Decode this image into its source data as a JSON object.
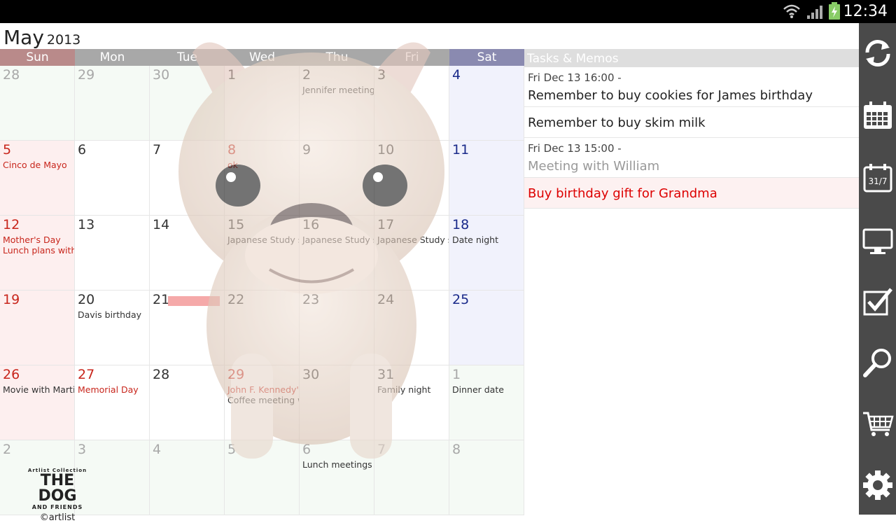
{
  "status": {
    "time": "12:34"
  },
  "calendar": {
    "month": "May",
    "year": "2013",
    "weekdays": [
      "Sun",
      "Mon",
      "Tue",
      "Wed",
      "Thu",
      "Fri",
      "Sat"
    ],
    "weeks": [
      [
        {
          "d": "28",
          "kind": "other"
        },
        {
          "d": "29",
          "kind": "other"
        },
        {
          "d": "30",
          "kind": "other"
        },
        {
          "d": "1"
        },
        {
          "d": "2",
          "events": [
            "Jennifer meeting"
          ]
        },
        {
          "d": "3"
        },
        {
          "d": "4"
        }
      ],
      [
        {
          "d": "5",
          "events": [
            "Cinco de Mayo"
          ],
          "evred": true
        },
        {
          "d": "6"
        },
        {
          "d": "7"
        },
        {
          "d": "8",
          "red": true,
          "events": [
            "ok"
          ],
          "evred": true
        },
        {
          "d": "9"
        },
        {
          "d": "10"
        },
        {
          "d": "11"
        }
      ],
      [
        {
          "d": "12",
          "events": [
            "Mother's Day",
            "Lunch plans with"
          ],
          "evred": true
        },
        {
          "d": "13"
        },
        {
          "d": "14"
        },
        {
          "d": "15",
          "events": [
            "Japanese Study s"
          ]
        },
        {
          "d": "16",
          "events": [
            "Japanese Study s"
          ]
        },
        {
          "d": "17",
          "events": [
            "Japanese Study s"
          ]
        },
        {
          "d": "18",
          "events": [
            "Date night"
          ]
        }
      ],
      [
        {
          "d": "19"
        },
        {
          "d": "20",
          "events": [
            "Davis birthday"
          ]
        },
        {
          "d": "21",
          "today": true
        },
        {
          "d": "22"
        },
        {
          "d": "23"
        },
        {
          "d": "24"
        },
        {
          "d": "25"
        }
      ],
      [
        {
          "d": "26",
          "events": [
            "Movie with Martin"
          ]
        },
        {
          "d": "27",
          "red": true,
          "events": [
            "Memorial Day"
          ],
          "evred": true
        },
        {
          "d": "28"
        },
        {
          "d": "29",
          "red": true,
          "events": [
            "John F. Kennedy's",
            "Coffee meeting w"
          ],
          "mixed": true
        },
        {
          "d": "30"
        },
        {
          "d": "31",
          "events": [
            "Family night"
          ]
        },
        {
          "d": "1",
          "kind": "other",
          "events": [
            "Dinner date"
          ]
        }
      ],
      [
        {
          "d": "2",
          "kind": "other"
        },
        {
          "d": "3",
          "kind": "other"
        },
        {
          "d": "4",
          "kind": "other"
        },
        {
          "d": "5",
          "kind": "other"
        },
        {
          "d": "6",
          "kind": "other",
          "events": [
            "Lunch meetings"
          ]
        },
        {
          "d": "7",
          "kind": "other"
        },
        {
          "d": "8",
          "kind": "other"
        }
      ]
    ]
  },
  "tasks": {
    "header": "Tasks & Memos",
    "items": [
      {
        "time": "Fri Dec 13 16:00 -",
        "text": "Remember to buy cookies for James birthday",
        "style": "normal"
      },
      {
        "time": "",
        "text": "Remember to buy skim milk",
        "style": "normal"
      },
      {
        "time": "Fri Dec 13 15:00 -",
        "text": "Meeting with William",
        "style": "gray"
      },
      {
        "time": "",
        "text": "Buy birthday gift for Grandma",
        "style": "red"
      }
    ]
  },
  "sidebar": {
    "buttons": [
      {
        "name": "sync-icon"
      },
      {
        "name": "month-calendar-icon"
      },
      {
        "name": "date-calendar-icon",
        "label": "31/7"
      },
      {
        "name": "display-icon"
      },
      {
        "name": "tasks-check-icon"
      },
      {
        "name": "search-icon"
      },
      {
        "name": "store-cart-icon"
      },
      {
        "name": "settings-gear-icon"
      }
    ]
  },
  "brand": {
    "top": "Artlist Collection",
    "main": "THE DOG",
    "sub": "AND FRIENDS",
    "copy": "©artlist"
  }
}
